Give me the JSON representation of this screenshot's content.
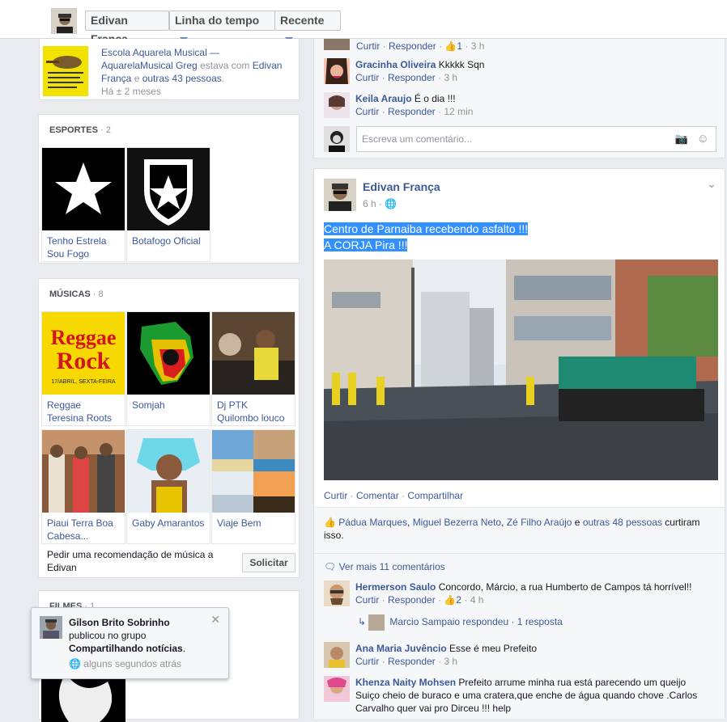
{
  "header": {
    "name": "Edivan França",
    "timeline": "Linha do tempo",
    "recent": "Recente"
  },
  "music_school": {
    "title": "Escola Aquarela Musical —",
    "line2a": "AquarelaMusical Greg",
    "line2b": " estava com ",
    "line2c": "Edivan",
    "line3a": "França",
    "line3b": " e ",
    "line3c": "outras 43 pessoas",
    "line3d": ".",
    "time": "Há ± 2 meses",
    "logo_text": "Escola Aquarela Musical"
  },
  "sports": {
    "title": "ESPORTES",
    "count": "· 2",
    "items": [
      {
        "label": "Tenho Estrela Sou Fogo"
      },
      {
        "label": "Botafogo Oficial"
      }
    ]
  },
  "music": {
    "title": "MÚSICAS",
    "count": "· 8",
    "items": [
      {
        "label": "Reggae Teresina Roots"
      },
      {
        "label": "Somjah"
      },
      {
        "label": "Dj PTK Quilombo louco"
      },
      {
        "label": "Piaui Terra Boa Cabesa..."
      },
      {
        "label": "Gaby Amarantos"
      },
      {
        "label": "Viaje Bem"
      }
    ],
    "reggae_top": "Reggae",
    "reggae_bot": "Rock",
    "reggae_date": "17/ABRIL, SEXTA-FEIRA",
    "recommend": "Pedir uma recomendação de música a Edivan",
    "request_btn": "Solicitar"
  },
  "films": {
    "title": "FILMES",
    "count": "· 1"
  },
  "notification": {
    "name": "Gilson Brito Sobrinho",
    "text1": "publicou no grupo",
    "group": "Compartilhando notícias",
    "dot": ".",
    "time": "alguns segundos atrás"
  },
  "top_post": {
    "c0": {
      "curtir": "Curtir",
      "resp": "Responder",
      "likes": "1",
      "time": "3 h"
    },
    "c1": {
      "name": "Gracinha Oliveira",
      "text": " Kkkkk Sqn",
      "curtir": "Curtir",
      "resp": "Responder",
      "time": "3 h"
    },
    "c2": {
      "name": "Keila Araujo",
      "text": " É o dia !!!",
      "curtir": "Curtir",
      "resp": "Responder",
      "time": "12 min"
    },
    "comment_placeholder": "Escreva um comentário..."
  },
  "post": {
    "author": "Edivan França",
    "time": "6 h",
    "line1": "Centro de Parnaiba recebendo asfalto !!!",
    "line2": "A CORJA Pira !!!",
    "actions": {
      "like": "Curtir",
      "comment": "Comentar",
      "share": "Compartilhar"
    },
    "likes": {
      "p1": "Pádua Marques",
      "p2": "Miguel Bezerra Neto",
      "p3": "Zé Filho Araújo",
      "others": "outras 48 pessoas",
      "e": " e ",
      "sep": ", ",
      "suffix": " curtiram isso."
    },
    "view_more": "Ver mais 11 comentários",
    "comments": [
      {
        "name": "Hermerson Saulo",
        "text": " Concordo, Márcio, a rua Humberto de Campos tá horrível!!",
        "curtir": "Curtir",
        "resp": "Responder",
        "likes": "2",
        "time": "4 h"
      },
      {
        "name": "Ana Maria Juvêncio",
        "text": " Esse é meu Prefeito",
        "curtir": "Curtir",
        "resp": "Responder",
        "time": "3 h"
      },
      {
        "name": "Khenza Naity Mohsen",
        "text": " Prefeito arrume minha rua está parecendo um queijo Suiço cheio de buraco e uma cratera,que enche de água quando chove .Carlos Carvalho quer vai pro Dirceu !!! help"
      }
    ],
    "reply": {
      "name": "Marcio Sampaio respondeu",
      "count": " · 1 resposta"
    }
  }
}
